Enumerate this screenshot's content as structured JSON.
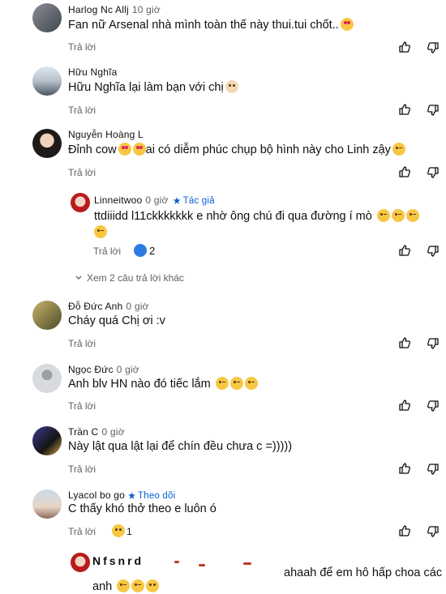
{
  "comments": [
    {
      "author": "Harlog Nc Allj",
      "time": "10 giờ",
      "text": "Fan nữ Arsenal nhà mình toàn thế này thui.tui chốt..",
      "reply_label": "Trả lời"
    },
    {
      "author": "Hữu Nghĩa",
      "time": "",
      "text": "Hữu Nghĩa lại làm bạn với chị",
      "reply_label": "Trả lời"
    },
    {
      "author": "Nguyễn Hoàng L",
      "time": "",
      "text": "Đỉnh cow",
      "text_suffix": "ai có diễm phúc chụp bộ hình này cho Linh zậy",
      "reply_label": "Trả lời"
    },
    {
      "author": "Linneitwoo",
      "time": "0 giờ",
      "tag": "Tác giả",
      "text": "ttdiiidd l11ckkkkkkk e nhờ ông chú đi qua đường í mò",
      "reply_label": "Trả lời",
      "like_count": "2"
    },
    {
      "more_replies": "Xem 2 câu trả lời khác"
    },
    {
      "author": "Đỗ Đức Anh",
      "time": "0 giờ",
      "text": "Cháy quá Chị ơi :v",
      "reply_label": "Trả lời"
    },
    {
      "author": "Ngọc Đức",
      "time": "0 giờ",
      "text": "Anh blv HN nào đó tiếc lắm",
      "reply_label": "Trả lời"
    },
    {
      "author": "Trần C",
      "time": "0 giờ",
      "text": "Này lật qua lật lại để chín đều chưa c =)))))",
      "reply_label": "Trả lời"
    },
    {
      "author": "Lyacol bo go",
      "tag": "Theo dõi",
      "text": "C thấy khó thở theo e luôn ó",
      "reply_label": "Trả lời",
      "like_count": "1"
    },
    {
      "author": "Nfsnrd",
      "text": "ahaah để em hô hấp choa các",
      "text2": "anh"
    }
  ],
  "icons": {
    "like": "thumbs-up-icon",
    "dislike": "thumbs-down-icon",
    "chevron": "chevron-down-icon"
  },
  "colors": {
    "link": "#065fd4",
    "muted": "#606060",
    "text": "#0f0f0f"
  }
}
